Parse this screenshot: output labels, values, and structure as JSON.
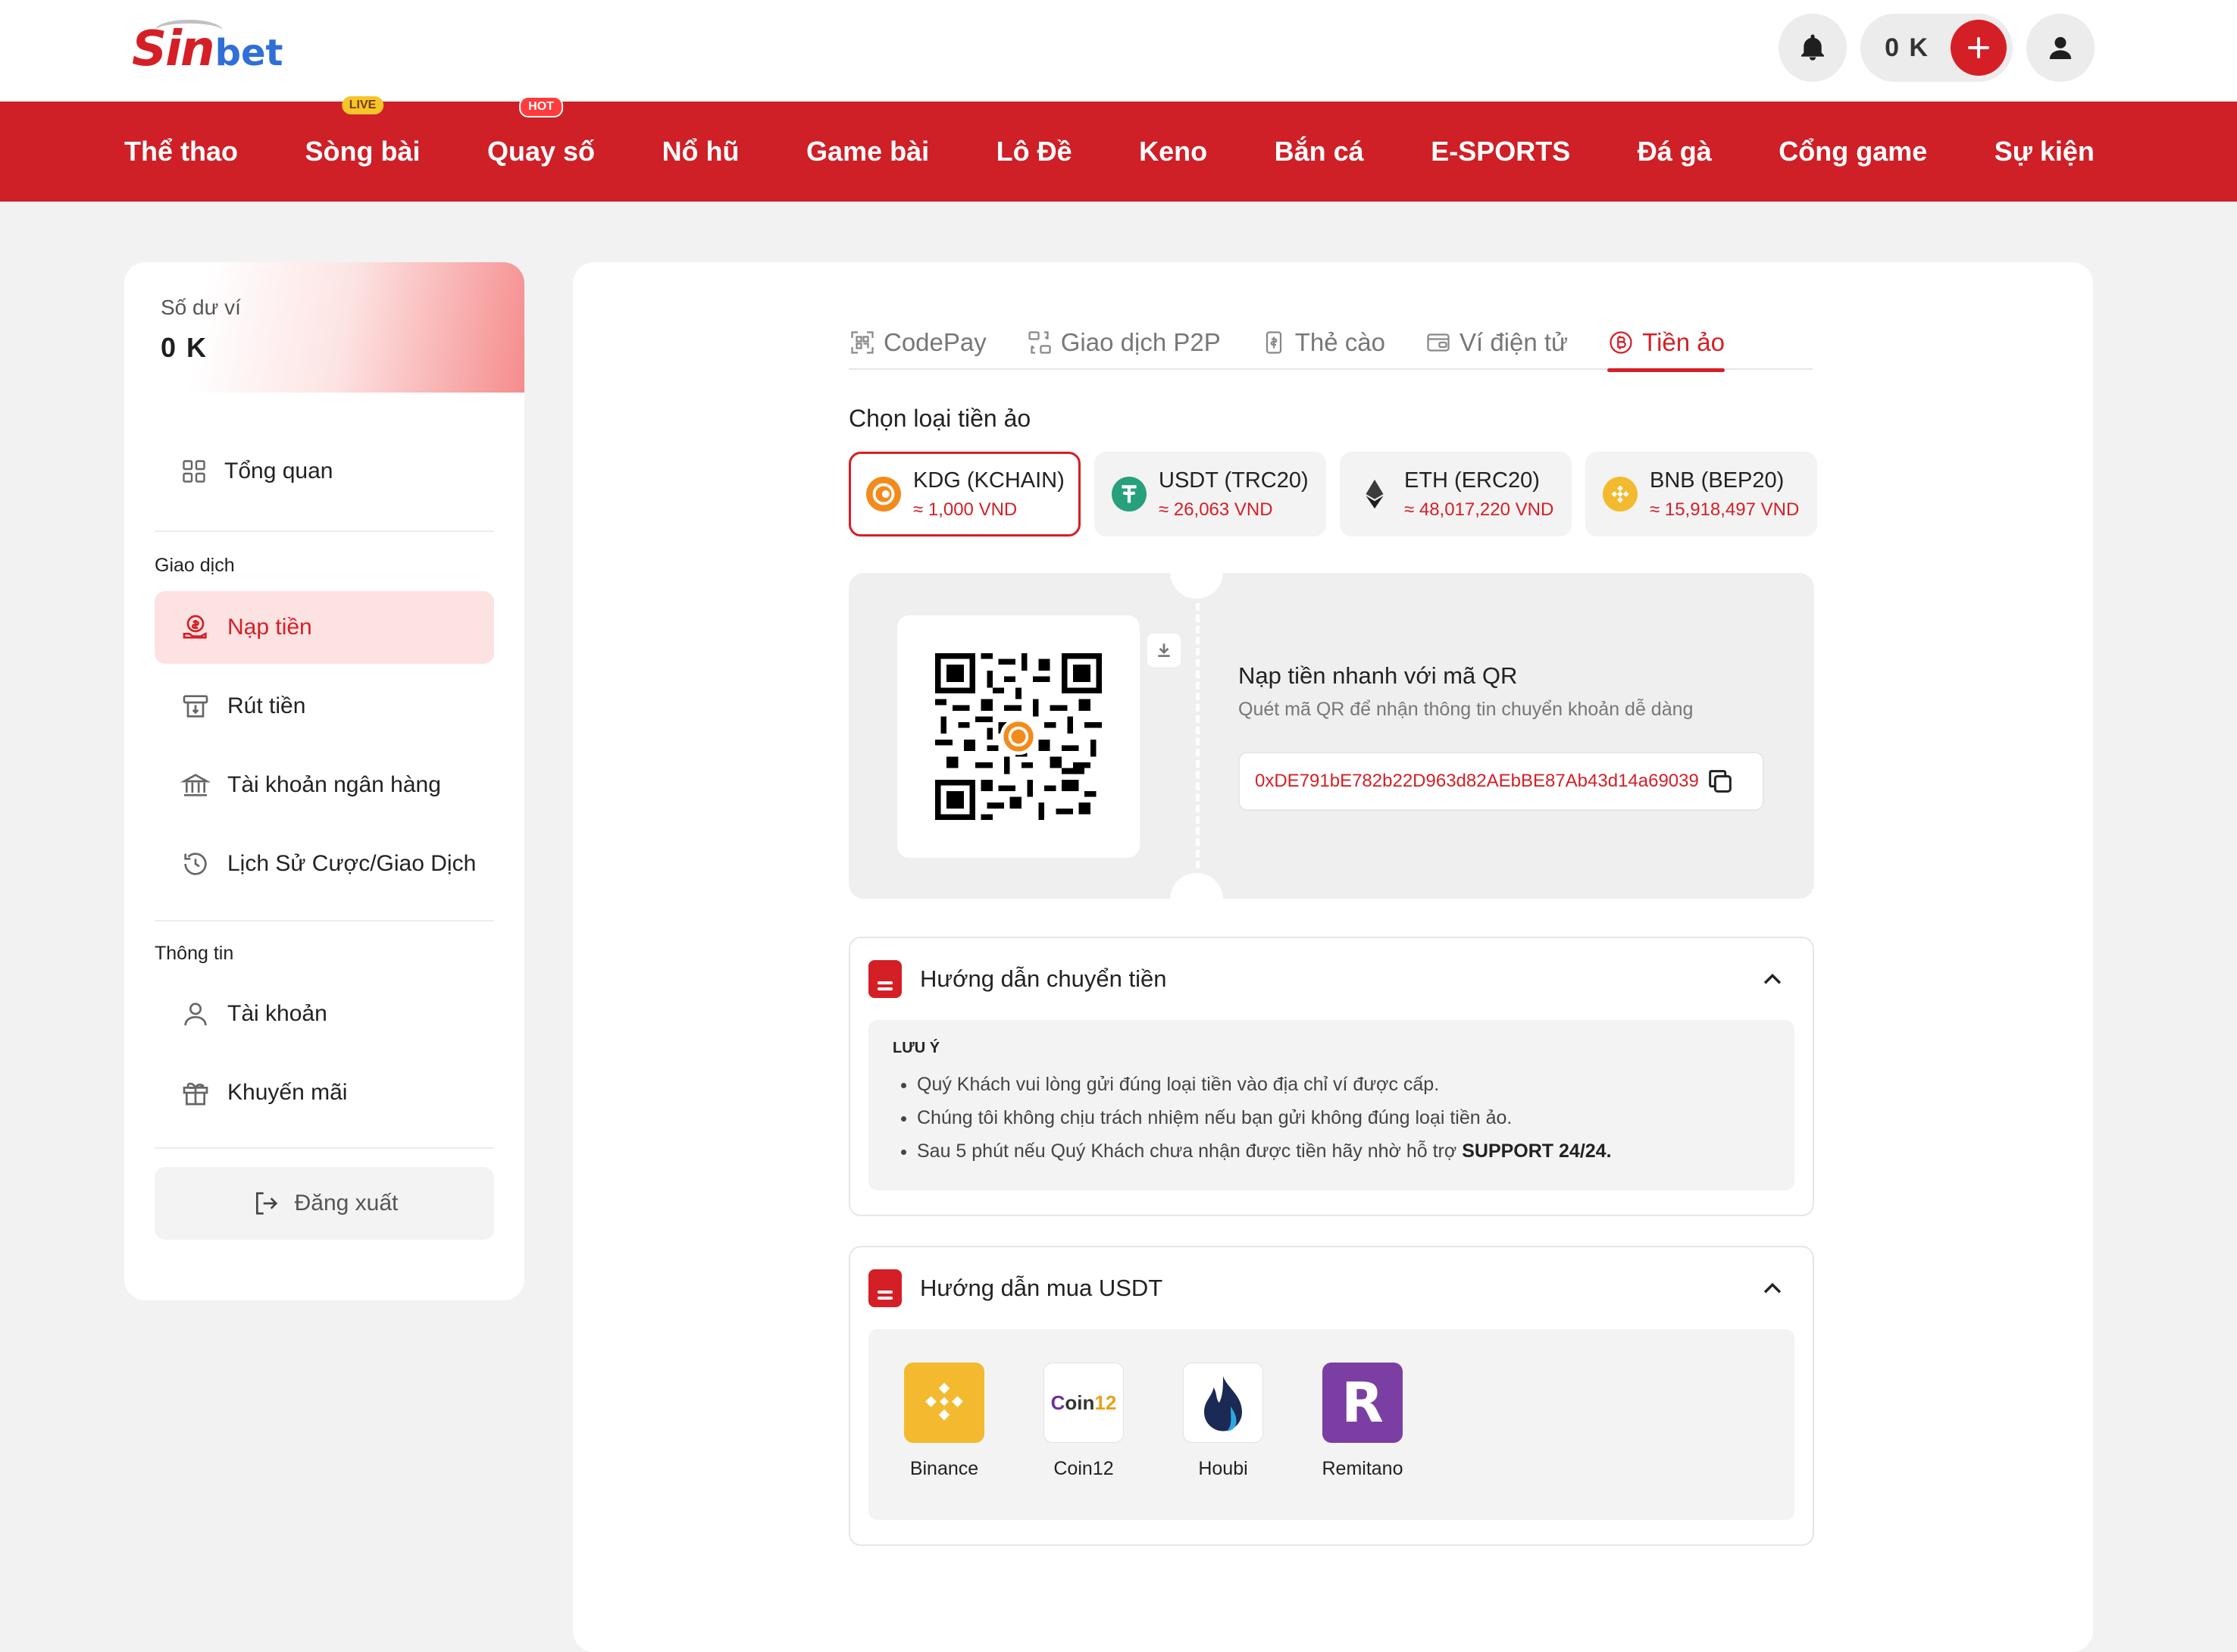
{
  "header": {
    "logo_main": "Sin",
    "logo_accent": "bet",
    "balance": "0 K"
  },
  "nav": {
    "items": [
      {
        "label": "Thể thao",
        "badge": ""
      },
      {
        "label": "Sòng bài",
        "badge": "LIVE"
      },
      {
        "label": "Quay số",
        "badge": "HOT"
      },
      {
        "label": "Nổ hũ",
        "badge": ""
      },
      {
        "label": "Game bài",
        "badge": ""
      },
      {
        "label": "Lô Đề",
        "badge": ""
      },
      {
        "label": "Keno",
        "badge": ""
      },
      {
        "label": "Bắn cá",
        "badge": ""
      },
      {
        "label": "E-SPORTS",
        "badge": ""
      },
      {
        "label": "Đá gà",
        "badge": ""
      },
      {
        "label": "Cổng game",
        "badge": ""
      },
      {
        "label": "Sự kiện",
        "badge": ""
      }
    ]
  },
  "sidebar": {
    "wallet_label": "Số dư ví",
    "wallet_value": "0 K",
    "overview": "Tổng quan",
    "group_transactions": "Giao dịch",
    "deposit": "Nạp tiền",
    "withdraw": "Rút tiền",
    "bank_account": "Tài khoản ngân hàng",
    "history": "Lịch Sử Cược/Giao Dịch",
    "group_info": "Thông tin",
    "account": "Tài khoản",
    "promotions": "Khuyến mãi",
    "logout": "Đăng xuất"
  },
  "tabs": [
    {
      "label": "CodePay",
      "active": false
    },
    {
      "label": "Giao dịch P2P",
      "active": false
    },
    {
      "label": "Thẻ cào",
      "active": false
    },
    {
      "label": "Ví điện tử",
      "active": false
    },
    {
      "label": "Tiền ảo",
      "active": true
    }
  ],
  "crypto": {
    "section_title": "Chọn loại tiền ảo",
    "coins": [
      {
        "name": "KDG (KCHAIN)",
        "rate": "≈ 1,000 VND",
        "color": "#f28b1c",
        "active": true
      },
      {
        "name": "USDT (TRC20)",
        "rate": "≈ 26,063 VND",
        "color": "#26a17b",
        "active": false
      },
      {
        "name": "ETH (ERC20)",
        "rate": "≈ 48,017,220 VND",
        "color": "#3c3c3d",
        "active": false
      },
      {
        "name": "BNB (BEP20)",
        "rate": "≈ 15,918,497 VND",
        "color": "#f3ba2f",
        "active": false
      }
    ]
  },
  "qr": {
    "title": "Nạp tiền nhanh với mã QR",
    "subtitle": "Quét mã QR để nhận thông tin chuyển khoản dễ dàng",
    "address": "0xDE791bE782b22D963d82AEbBE87Ab43d14a69039"
  },
  "guide_transfer": {
    "title": "Hướng dẫn chuyển tiền",
    "note_heading": "LƯU Ý",
    "note_1": "Quý Khách vui lòng gửi đúng loại tiền vào địa chỉ ví được cấp.",
    "note_2": "Chúng tôi không chịu trách nhiệm nếu bạn gửi không đúng loại tiền ảo.",
    "note_3_prefix": "Sau 5 phút nếu Quý Khách chưa nhận được tiền hãy nhờ hỗ trợ ",
    "note_3_bold": "SUPPORT 24/24."
  },
  "guide_usdt": {
    "title": "Hướng dẫn mua USDT",
    "apps": [
      {
        "name": "Binance",
        "color": "#f3ba2f"
      },
      {
        "name": "Coin12",
        "color": "#ffffff"
      },
      {
        "name": "Houbi",
        "color": "#ffffff"
      },
      {
        "name": "Remitano",
        "color": "#7b3fa3"
      }
    ]
  }
}
